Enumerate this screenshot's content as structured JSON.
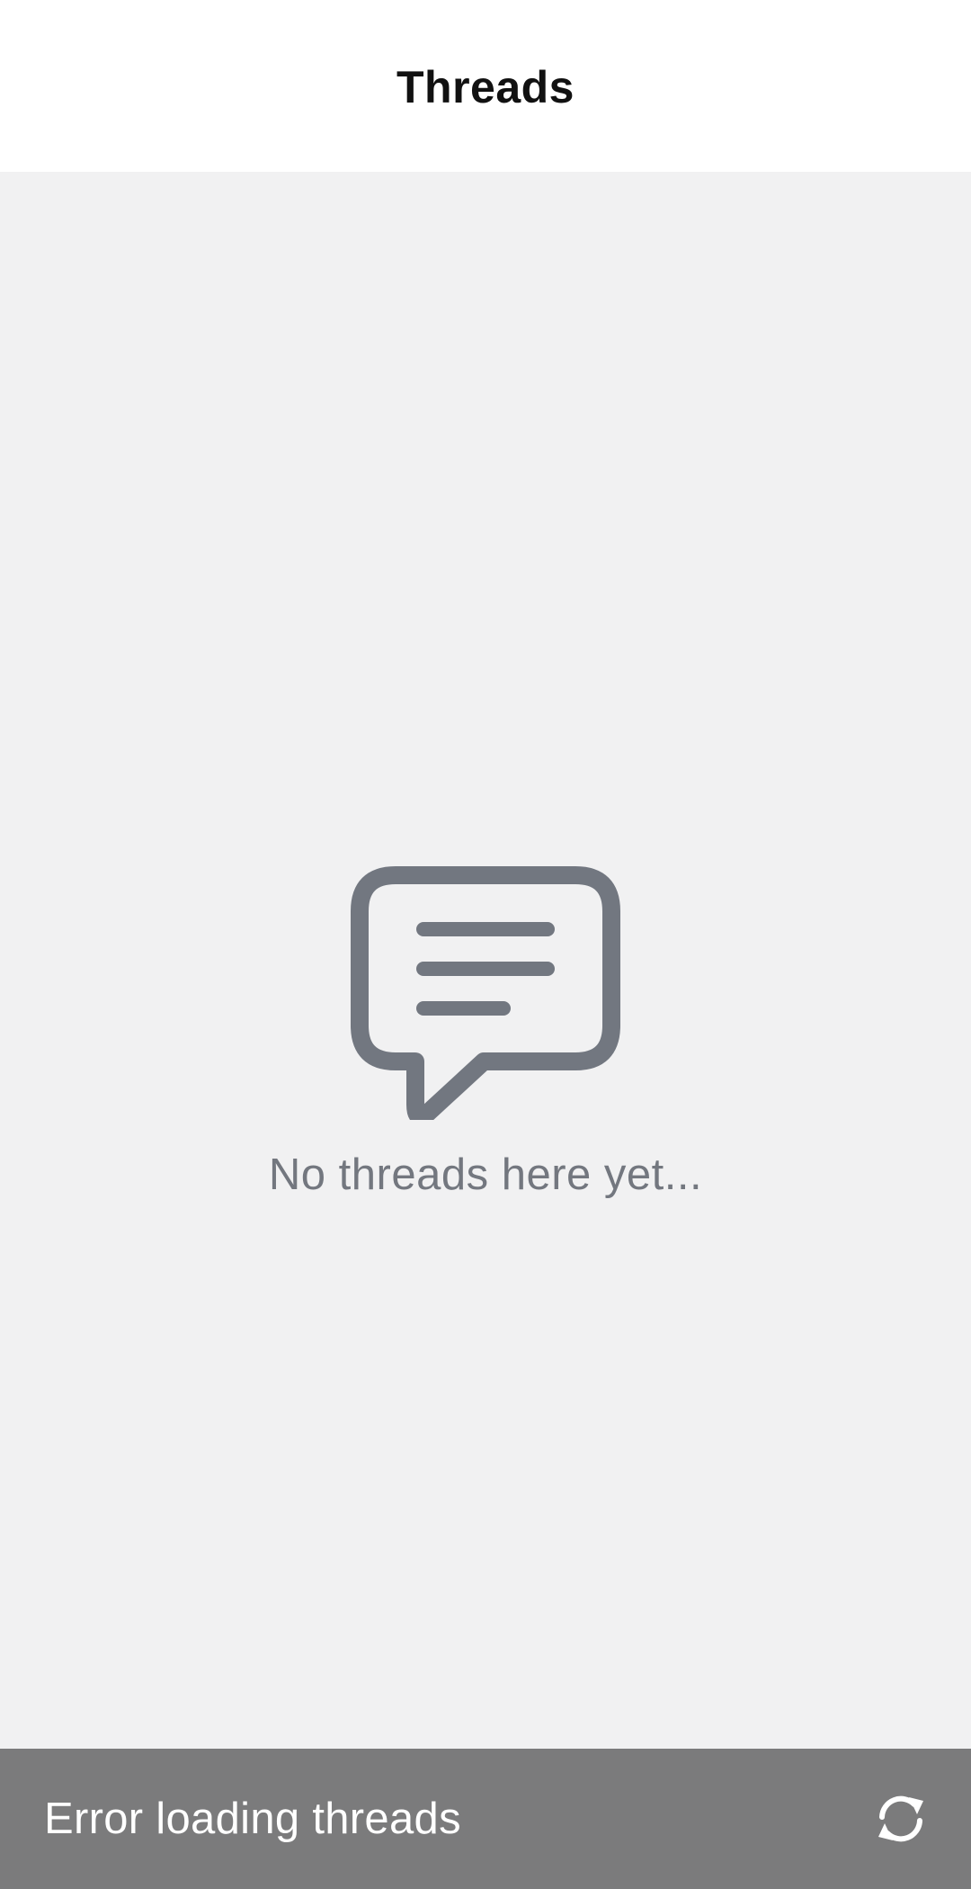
{
  "header": {
    "title": "Threads"
  },
  "empty_state": {
    "icon": "chat-bubble-icon",
    "message": "No threads here yet..."
  },
  "snackbar": {
    "message": "Error loading threads",
    "action_icon": "refresh-icon"
  },
  "colors": {
    "header_bg": "#ffffff",
    "content_bg": "#f1f1f2",
    "icon_gray": "#727780",
    "snackbar_bg": "#7b7b7c",
    "snackbar_text": "#ffffff"
  }
}
